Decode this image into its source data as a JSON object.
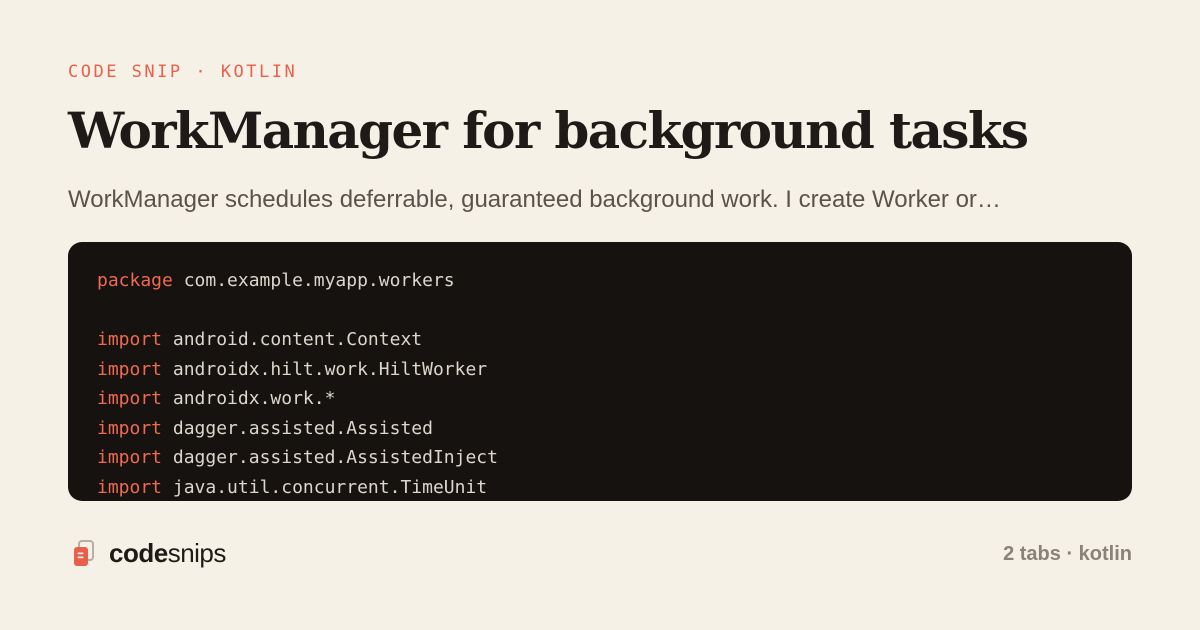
{
  "kicker": "CODE SNIP · KOTLIN",
  "title": "WorkManager for background tasks",
  "description": "WorkManager schedules deferrable, guaranteed background work. I create Worker or…",
  "code": {
    "lines": [
      {
        "keyword": "package",
        "rest": " com.example.myapp.workers"
      },
      {
        "keyword": "",
        "rest": ""
      },
      {
        "keyword": "import",
        "rest": " android.content.Context"
      },
      {
        "keyword": "import",
        "rest": " androidx.hilt.work.HiltWorker"
      },
      {
        "keyword": "import",
        "rest": " androidx.work.*"
      },
      {
        "keyword": "import",
        "rest": " dagger.assisted.Assisted"
      },
      {
        "keyword": "import",
        "rest": " dagger.assisted.AssistedInject"
      },
      {
        "keyword": "import",
        "rest": " java.util.concurrent.TimeUnit"
      }
    ]
  },
  "footer": {
    "brand_bold": "code",
    "brand_light": "snips",
    "logo_icon": "stacked-pages-icon",
    "meta": "2 tabs · kotlin"
  },
  "colors": {
    "background": "#f6f1e6",
    "accent": "#e8604c",
    "code_background": "#151210",
    "keyword": "#f06a4f",
    "code_text": "#ddd6cc"
  }
}
